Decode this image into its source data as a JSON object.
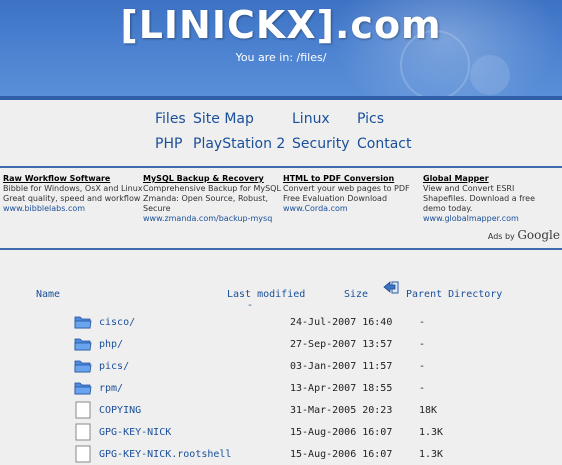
{
  "header": {
    "logo": "[LINICKX].com",
    "location": "You are in: /files/"
  },
  "nav": {
    "files": "Files",
    "sitemap": "Site Map",
    "linux": "Linux",
    "pics": "Pics",
    "php": "PHP",
    "playstation": "PlayStation 2",
    "security": "Security",
    "contact": "Contact"
  },
  "ads": [
    {
      "title": "Raw Workflow Software",
      "desc": "Bibble for Windows, OsX and Linux Great quality, speed and workflow",
      "url": "www.bibblelabs.com"
    },
    {
      "title": "MySQL Backup & Recovery",
      "desc": "Comprehensive Backup for MySQL Zmanda: Open Source, Robust, Secure",
      "url": "www.zmanda.com/backup-mysq"
    },
    {
      "title": "HTML to PDF Conversion",
      "desc": "Convert your web pages to PDF Free Evaluation Download",
      "url": "www.Corda.com"
    },
    {
      "title": "Global Mapper",
      "desc": "View and Convert ESRI Shapefiles. Download a free demo today.",
      "url": "www.globalmapper.com"
    }
  ],
  "ads_by": "Ads by",
  "ads_google": "Google",
  "listing": {
    "headers": {
      "name": "Name",
      "modified": "Last modified",
      "size": "Size",
      "parent": "Parent Directory"
    },
    "sort_marker": "-",
    "rows": [
      {
        "type": "folder",
        "name": "cisco/",
        "date": "24-Jul-2007 16:40",
        "size": "-"
      },
      {
        "type": "folder",
        "name": "php/",
        "date": "27-Sep-2007 13:57",
        "size": "-"
      },
      {
        "type": "folder",
        "name": "pics/",
        "date": "03-Jan-2007 11:57",
        "size": "-"
      },
      {
        "type": "folder",
        "name": "rpm/",
        "date": "13-Apr-2007 18:55",
        "size": "-"
      },
      {
        "type": "file",
        "name": "COPYING",
        "date": "31-Mar-2005 20:23",
        "size": "18K"
      },
      {
        "type": "file",
        "name": "GPG-KEY-NICK",
        "date": "15-Aug-2006 16:07",
        "size": "1.3K"
      },
      {
        "type": "file",
        "name": "GPG-KEY-NICK.rootshell",
        "date": "15-Aug-2006 16:07",
        "size": "1.3K"
      }
    ]
  },
  "colors": {
    "header_blue": "#4a80cf",
    "link_blue": "#1a4f9a",
    "rule_blue": "#3d6db0",
    "background": "#efefef"
  }
}
